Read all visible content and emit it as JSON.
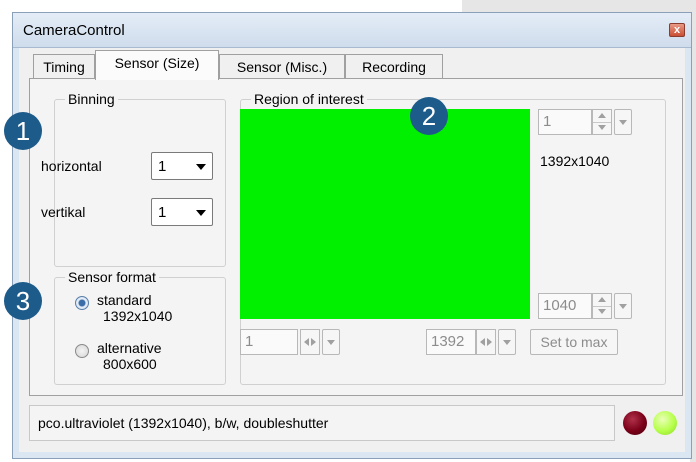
{
  "window": {
    "title": "CameraControl",
    "close_glyph": "x"
  },
  "tabs": [
    {
      "label": "Timing"
    },
    {
      "label": "Sensor (Size)"
    },
    {
      "label": "Sensor (Misc.)"
    },
    {
      "label": "Recording"
    }
  ],
  "binning": {
    "title": "Binning",
    "horizontal_label": "horizontal",
    "horizontal_value": "1",
    "vertikal_label": "vertikal",
    "vertikal_value": "1"
  },
  "sensor_format": {
    "title": "Sensor format",
    "options": [
      {
        "line1": "standard",
        "line2": "1392x1040",
        "selected": true
      },
      {
        "line1": "alternative",
        "line2": "800x600",
        "selected": false
      }
    ]
  },
  "roi": {
    "title": "Region of interest",
    "fill_color": "#00f000",
    "top_value": "1",
    "size_readout": "1392x1040",
    "bottom_value": "1040",
    "left_value": "1",
    "right_value": "1392",
    "set_to_max_label": "Set to max"
  },
  "status": {
    "text": "pco.ultraviolet (1392x1040), b/w, doubleshutter",
    "led_red": "#7a0018",
    "led_green": "#b6ff4a"
  },
  "badges": [
    "1",
    "2",
    "3"
  ]
}
